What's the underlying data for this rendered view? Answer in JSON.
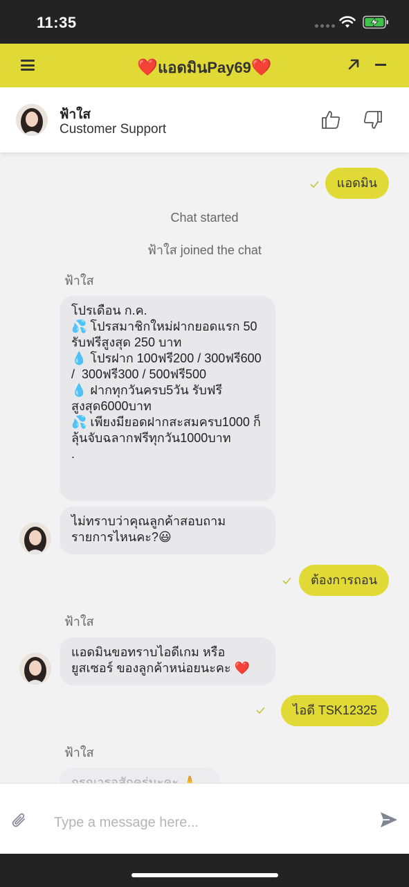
{
  "status_bar": {
    "time": "11:35"
  },
  "header": {
    "title": "แอดมินPay69",
    "heart": "❤️",
    "accent_color": "#e1d935",
    "icons": [
      "menu-icon",
      "expand-icon",
      "minimize-icon"
    ]
  },
  "agent": {
    "name": "ฟ้าใส",
    "role": "Customer Support",
    "icons": [
      "thumbs-up-icon",
      "thumbs-down-icon"
    ]
  },
  "messages": {
    "m1": "แอดมิน",
    "chat_started": "Chat started",
    "joined": "ฟ้าใส joined the chat",
    "sender1": "ฟ้าใส",
    "promo": "โปรเดือน ก.ค.\n💦 โปรสมาชิกใหม่ฝากยอดแรก 50 รับฟรีสูงสุด 250 บาท\n💧 โปรฝาก 100ฟรี200 / 300ฟรี600 /  300ฟรี300 / 500ฟรี500\n💧 ฝากทุกวันครบ5วัน รับฟรีสูงสุด6000บาท\n💦 เพียงมียอดฝากสะสมครบ1000 ก็ลุ้นจับฉลากฟรีทุกวัน1000บาท\n.",
    "ask": "ไม่ทราบว่าคุณลูกค้าสอบถามรายการไหนคะ?😃",
    "m2": "ต้องการถอน",
    "sender2": "ฟ้าใส",
    "ask_id": "แอดมินขอทราบไอดีเกม หรือยูสเซอร์ ของลูกค้าหน่อยนะคะ ❤️",
    "m3": "ไอดี TSK12325",
    "sender3": "ฟ้าใส",
    "partial": "กรุณารอสักครู่นะคะ 🙏"
  },
  "composer": {
    "placeholder": "Type a message here...",
    "icons": [
      "paperclip-icon",
      "send-icon"
    ]
  }
}
